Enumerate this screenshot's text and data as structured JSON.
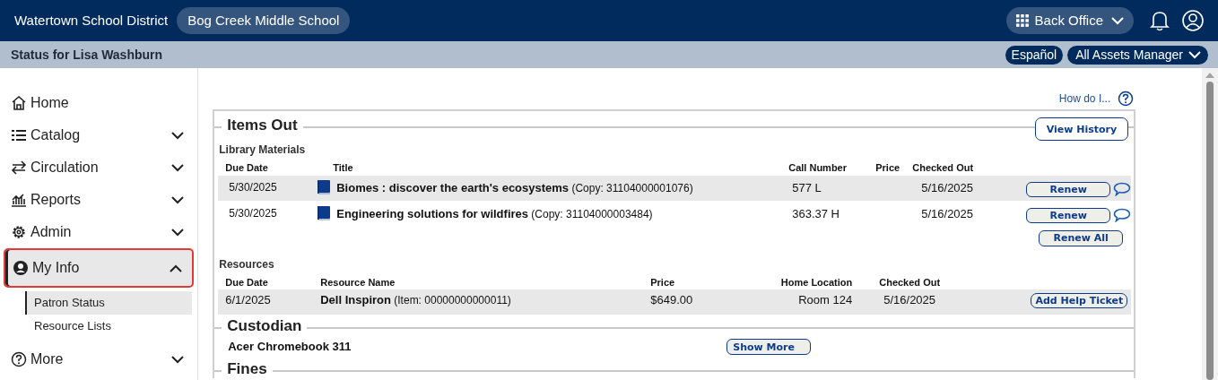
{
  "header": {
    "district": "Watertown School District",
    "school": "Bog Creek Middle School",
    "back_office": "Back Office"
  },
  "subbar": {
    "title": "Status for Lisa Washburn",
    "language_button": "Español",
    "role_button": "All Assets Manager"
  },
  "sidebar": {
    "items": [
      {
        "label": "Home",
        "kind": "link",
        "selected": false
      },
      {
        "label": "Catalog",
        "kind": "menu",
        "expanded": false,
        "selected": false
      },
      {
        "label": "Circulation",
        "kind": "menu",
        "expanded": false,
        "selected": false
      },
      {
        "label": "Reports",
        "kind": "menu",
        "expanded": false,
        "selected": false
      },
      {
        "label": "Admin",
        "kind": "menu",
        "expanded": false,
        "selected": false
      },
      {
        "label": "My Info",
        "kind": "menu",
        "expanded": true,
        "selected": true,
        "children": [
          {
            "label": "Patron Status",
            "selected": true
          },
          {
            "label": "Resource Lists",
            "selected": false
          }
        ]
      },
      {
        "label": "More",
        "kind": "menu",
        "expanded": false,
        "selected": false
      }
    ]
  },
  "help_link": "How do I...",
  "items_out": {
    "title": "Items Out",
    "view_history": "View History",
    "library_materials": {
      "title": "Library Materials",
      "columns": [
        "Due Date",
        "Title",
        "Call Number",
        "Price",
        "Checked Out"
      ],
      "rows": [
        {
          "due_date": "5/30/2025",
          "title": "**Biomes : discover the earth's ecosystems** (Copy: 31104000001076)",
          "call_number": "577 L",
          "checked_out": "5/16/2025",
          "action": "Renew"
        },
        {
          "due_date": "5/30/2025",
          "title": "**Engineering solutions for wildfires** (Copy: 31104000003484)",
          "call_number": "363.37 H",
          "checked_out": "5/16/2025",
          "action": "Renew"
        }
      ],
      "renew_all": "Renew All"
    },
    "resources": {
      "title": "Resources",
      "columns": [
        "Due Date",
        "Resource Name",
        "Price",
        "Home Location",
        "Checked Out"
      ],
      "rows": [
        {
          "due_date": "6/1/2025",
          "name": "**Dell Inspiron** (Item: 00000000000011)",
          "price": "$649.00",
          "home_location": "Room 124",
          "checked_out": "5/16/2025",
          "action": "Add Help Ticket"
        }
      ]
    }
  },
  "custodian": {
    "title": "Custodian",
    "item": "Acer Chromebook 311",
    "show_more": "Show More"
  },
  "fines": {
    "title": "Fines"
  }
}
